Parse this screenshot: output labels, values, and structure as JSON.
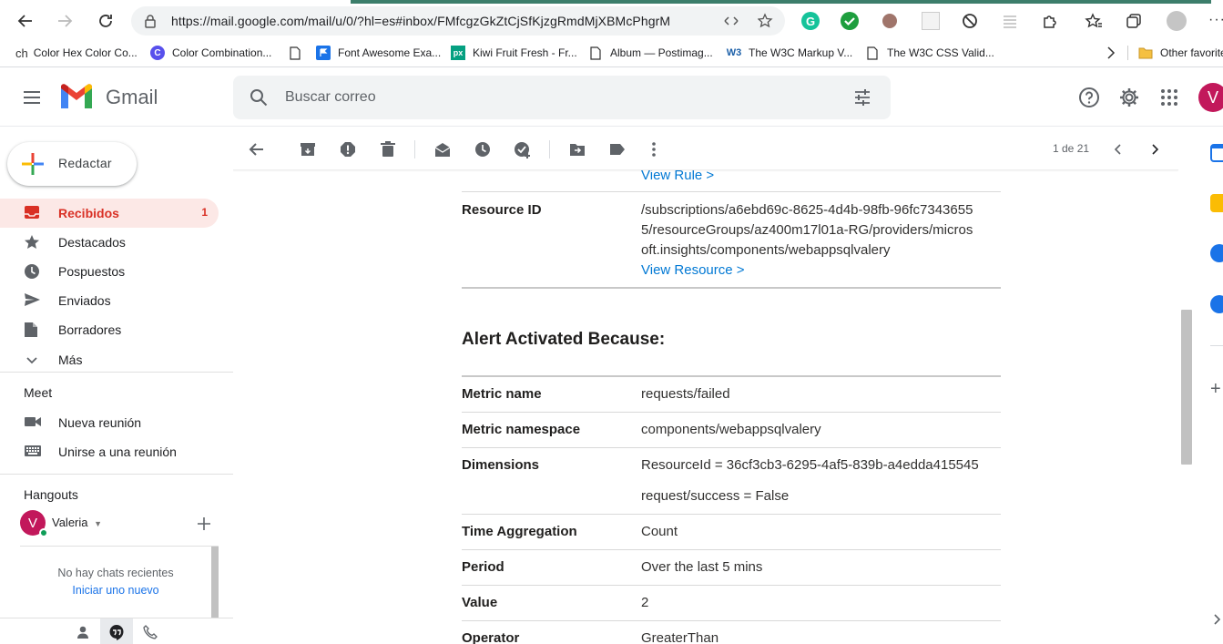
{
  "browser": {
    "url": "https://mail.google.com/mail/u/0/?hl=es#inbox/FMfcgzGkZtCjSfKjzgRmdMjXBMcPhgrM",
    "bookmarks": [
      {
        "label": "Color Hex Color Co...",
        "icon": "ch"
      },
      {
        "label": "Color Combination...",
        "icon": "C"
      },
      {
        "label": "",
        "icon": "doc"
      },
      {
        "label": "Font Awesome Exa...",
        "icon": "flag"
      },
      {
        "label": "Kiwi Fruit Fresh - Fr...",
        "icon": "px"
      },
      {
        "label": "Album — Postimag...",
        "icon": "doc"
      },
      {
        "label": "The W3C Markup V...",
        "icon": "W3"
      },
      {
        "label": "The W3C CSS Valid...",
        "icon": "doc"
      }
    ],
    "other_favorites": "Other favorite"
  },
  "header": {
    "app_name": "Gmail",
    "search_placeholder": "Buscar correo",
    "avatar_letter": "V"
  },
  "nav": {
    "compose": "Redactar",
    "items": [
      {
        "label": "Recibidos",
        "count": "1",
        "icon": "inbox-icon"
      },
      {
        "label": "Destacados",
        "count": "",
        "icon": "star-icon"
      },
      {
        "label": "Pospuestos",
        "count": "",
        "icon": "clock-icon"
      },
      {
        "label": "Enviados",
        "count": "",
        "icon": "send-icon"
      },
      {
        "label": "Borradores",
        "count": "",
        "icon": "draft-icon"
      },
      {
        "label": "Más",
        "count": "",
        "icon": "chevron-down-icon"
      }
    ],
    "meet": {
      "title": "Meet",
      "new_meeting": "Nueva reunión",
      "join_meeting": "Unirse a una reunión"
    },
    "hangouts": {
      "title": "Hangouts",
      "user": "Valeria",
      "avatar_letter": "V",
      "no_chats": "No hay chats recientes",
      "start_new": "Iniciar uno nuevo"
    }
  },
  "toolbar": {
    "pager": "1 de 21"
  },
  "email": {
    "view_rule": "View Rule >",
    "resource_id_label": "Resource ID",
    "resource_id_value": "/subscriptions/a6ebd69c-8625-4d4b-98fb-96fc73436555/resourceGroups/az400m17l01a-RG/providers/microsoft.insights/components/webappsqlvalery",
    "resource_id_lines": [
      "/subscriptions/a6ebd69c-8625-4d4b-98fb-96fc7343655",
      "5/resourceGroups/az400m17l01a-RG/providers/micros",
      "oft.insights/components/webappsqlvalery"
    ],
    "view_resource": "View Resource >",
    "heading": "Alert Activated Because:",
    "rows": [
      {
        "key": "Metric name",
        "value": "requests/failed"
      },
      {
        "key": "Metric namespace",
        "value": "components/webappsqlvalery"
      },
      {
        "key": "Dimensions",
        "value": "ResourceId = 36cf3cb3-6295-4af5-839b-a4edda415545",
        "value2": "request/success = False"
      },
      {
        "key": "Time Aggregation",
        "value": "Count"
      },
      {
        "key": "Period",
        "value": "Over the last 5 mins"
      },
      {
        "key": "Value",
        "value": "2"
      },
      {
        "key": "Operator",
        "value": "GreaterThan"
      }
    ]
  },
  "colors": {
    "accent_red": "#d93025",
    "link_blue": "#0078d4",
    "avatar": "#c2185b"
  }
}
